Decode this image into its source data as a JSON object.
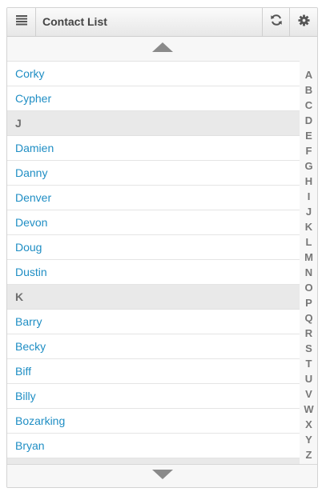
{
  "header": {
    "title": "Contact List"
  },
  "list": {
    "rows": [
      {
        "type": "item",
        "label": "Corky"
      },
      {
        "type": "item",
        "label": "Cypher"
      },
      {
        "type": "divider",
        "label": "J"
      },
      {
        "type": "item",
        "label": "Damien"
      },
      {
        "type": "item",
        "label": "Danny"
      },
      {
        "type": "item",
        "label": "Denver"
      },
      {
        "type": "item",
        "label": "Devon"
      },
      {
        "type": "item",
        "label": "Doug"
      },
      {
        "type": "item",
        "label": "Dustin"
      },
      {
        "type": "divider",
        "label": "K"
      },
      {
        "type": "item",
        "label": "Barry"
      },
      {
        "type": "item",
        "label": "Becky"
      },
      {
        "type": "item",
        "label": "Biff"
      },
      {
        "type": "item",
        "label": "Billy"
      },
      {
        "type": "item",
        "label": "Bozarking"
      },
      {
        "type": "item",
        "label": "Bryan"
      },
      {
        "type": "divider",
        "label": ""
      }
    ]
  },
  "alphabet": [
    "A",
    "B",
    "C",
    "D",
    "E",
    "F",
    "G",
    "H",
    "I",
    "J",
    "K",
    "L",
    "M",
    "N",
    "O",
    "P",
    "Q",
    "R",
    "S",
    "T",
    "U",
    "V",
    "W",
    "X",
    "Y",
    "Z"
  ],
  "icons": {
    "menu": "menu-icon",
    "refresh": "refresh-icon",
    "settings": "gear-icon",
    "scroll_up": "triangle-up-icon",
    "scroll_down": "triangle-down-icon"
  },
  "colors": {
    "link": "#1f8ec4",
    "divider_bg": "#e9e9e9",
    "divider_text": "#6f6f6f",
    "index_text": "#777777",
    "arrow": "#8a8a8a"
  }
}
